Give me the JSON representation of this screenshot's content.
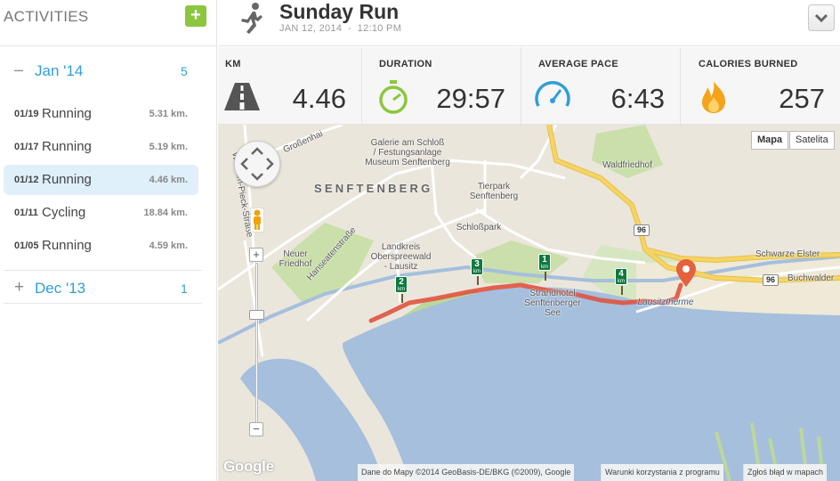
{
  "sidebar": {
    "title": "ACTIVITIES",
    "add_label": "+",
    "months": [
      {
        "toggle": "–",
        "label": "Jan '14",
        "count": "5",
        "activities": [
          {
            "date": "01/19",
            "type": "Running",
            "distance": "5.31 km.",
            "selected": false
          },
          {
            "date": "01/17",
            "type": "Running",
            "distance": "5.19 km.",
            "selected": false
          },
          {
            "date": "01/12",
            "type": "Running",
            "distance": "4.46 km.",
            "selected": true
          },
          {
            "date": "01/11",
            "type": "Cycling",
            "distance": "18.84 km.",
            "selected": false
          },
          {
            "date": "01/05",
            "type": "Running",
            "distance": "4.59 km.",
            "selected": false
          }
        ]
      },
      {
        "toggle": "+",
        "label": "Dec '13",
        "count": "1"
      }
    ]
  },
  "header": {
    "title": "Sunday Run",
    "date": "JAN 12, 2014",
    "separator": "-",
    "time": "12:10 PM",
    "icon": "runner-icon"
  },
  "stats": [
    {
      "label": "KM",
      "value": "4.46",
      "icon": "road-icon"
    },
    {
      "label": "DURATION",
      "value": "29:57",
      "icon": "stopwatch-icon"
    },
    {
      "label": "AVERAGE PACE",
      "value": "6:43",
      "icon": "speedometer-icon"
    },
    {
      "label": "CALORIES BURNED",
      "value": "257",
      "icon": "flame-icon"
    }
  ],
  "map": {
    "map_types": [
      "Mapa",
      "Satelita"
    ],
    "active_type": "Mapa",
    "zoom_in": "+",
    "zoom_out": "−",
    "town_name": "SENFTENBERG",
    "labels": {
      "grossenhain": "Großenhai",
      "galerie": "Galerie am Schloß\n/ Festungsanlage\nMuseum Senftenberg",
      "tierpark": "Tierpark\nSenftenberg",
      "schlosspark": "Schloßpark",
      "landkreis": "Landkreis\nOberspreewald\n- Lausitz",
      "neuer_friedhof": "Neuer\nFriedhof",
      "waldfriedhof": "Waldfriedhof",
      "strandhotel": "Strandhotel\nSenftenberger\nSee",
      "lausitztherme": "Lausitztherme",
      "schwarze_elster": "Schwarze Elster",
      "buchwalder": "Buchwalder",
      "hanseatenstrasse": "Hanseatenstraße",
      "wilhelm_pieck": "Wilhelm-Pieck-Straße"
    },
    "road_number": "96",
    "km_markers": [
      "2",
      "3",
      "1",
      "4"
    ],
    "km_unit": "km",
    "google_logo": "Google",
    "credits": {
      "data": "Dane do Mapy ©2014 GeoBasis-DE/BKG (©2009), Google",
      "terms": "Warunki korzystania z programu",
      "report": "Zgłoś błąd w mapach"
    },
    "colors": {
      "water": "#a5bfdd",
      "park": "#cadfaa",
      "route": "#e0533f",
      "highway": "#f5d467"
    }
  }
}
